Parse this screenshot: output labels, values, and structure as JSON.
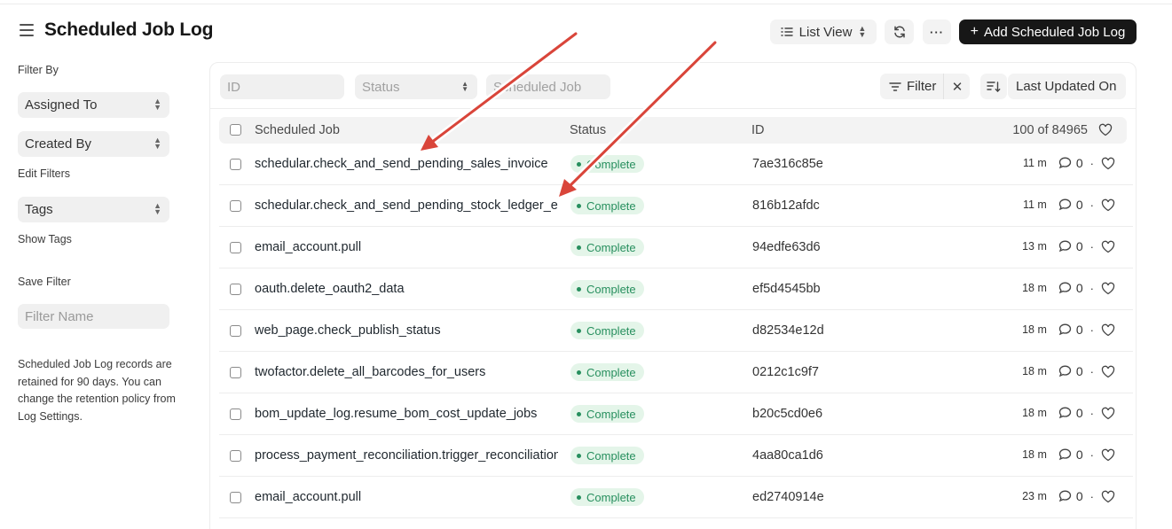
{
  "header": {
    "title": "Scheduled Job Log",
    "list_view_label": "List View",
    "more_label": "···",
    "add_label": "Add Scheduled Job Log"
  },
  "sidebar": {
    "filter_by": "Filter By",
    "assigned_to": "Assigned To",
    "created_by": "Created By",
    "edit_filters": "Edit Filters",
    "tags": "Tags",
    "show_tags": "Show Tags",
    "save_filter": "Save Filter",
    "filter_name_placeholder": "Filter Name",
    "retention_note": "Scheduled Job Log records are retained for 90 days. You can change the retention policy from Log Settings."
  },
  "filters": {
    "id_placeholder": "ID",
    "status_placeholder": "Status",
    "scheduled_job_placeholder": "Scheduled Job",
    "filter_label": "Filter",
    "sort_label": "Last Updated On"
  },
  "table": {
    "columns": {
      "scheduled_job": "Scheduled Job",
      "status": "Status",
      "id": "ID"
    },
    "count": "100 of 84965",
    "rows": [
      {
        "job": "schedular.check_and_send_pending_sales_invoice",
        "status": "Complete",
        "id": "7ae316c85e",
        "ago": "11 m",
        "comments": "0"
      },
      {
        "job": "schedular.check_and_send_pending_stock_ledger_entries",
        "status": "Complete",
        "id": "816b12afdc",
        "ago": "11 m",
        "comments": "0"
      },
      {
        "job": "email_account.pull",
        "status": "Complete",
        "id": "94edfe63d6",
        "ago": "13 m",
        "comments": "0"
      },
      {
        "job": "oauth.delete_oauth2_data",
        "status": "Complete",
        "id": "ef5d4545bb",
        "ago": "18 m",
        "comments": "0"
      },
      {
        "job": "web_page.check_publish_status",
        "status": "Complete",
        "id": "d82534e12d",
        "ago": "18 m",
        "comments": "0"
      },
      {
        "job": "twofactor.delete_all_barcodes_for_users",
        "status": "Complete",
        "id": "0212c1c9f7",
        "ago": "18 m",
        "comments": "0"
      },
      {
        "job": "bom_update_log.resume_bom_cost_update_jobs",
        "status": "Complete",
        "id": "b20c5cd0e6",
        "ago": "18 m",
        "comments": "0"
      },
      {
        "job": "process_payment_reconciliation.trigger_reconciliation_for_queued_docs",
        "status": "Complete",
        "id": "4aa80ca1d6",
        "ago": "18 m",
        "comments": "0"
      },
      {
        "job": "email_account.pull",
        "status": "Complete",
        "id": "ed2740914e",
        "ago": "23 m",
        "comments": "0"
      }
    ]
  },
  "colors": {
    "accent_dark": "#171717",
    "status_green": "#278f5e",
    "status_green_bg": "#e4f5e9",
    "annotation_arrow": "#d9453a"
  }
}
